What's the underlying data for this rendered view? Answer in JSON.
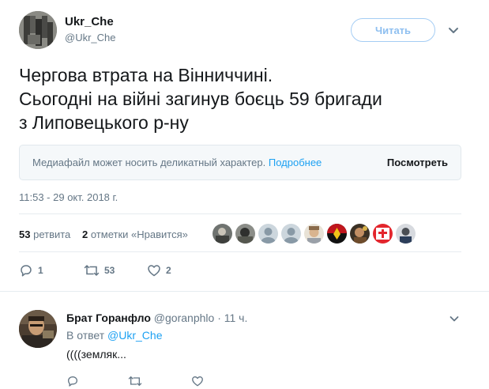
{
  "tweet": {
    "author_name": "Ukr_Che",
    "author_handle": "@Ukr_Che",
    "follow_label": "Читать",
    "text_lines": [
      "Чергова втрата на Вінниччині.",
      "Сьогодні на війні загинув боєць 59 бригади",
      "з Липовецького р-ну"
    ],
    "media_warning": {
      "message": "Медиафайл может носить деликатный характер.",
      "more_link": "Подробнее",
      "view_label": "Посмотреть"
    },
    "timestamp": "11:53 - 29 окт. 2018 г.",
    "stats": {
      "retweets_count": "53",
      "retweets_label": "ретвита",
      "likes_count": "2",
      "likes_label": "отметки «Нравится»"
    },
    "actions": {
      "reply_count": "1",
      "retweet_count": "53",
      "like_count": "2"
    }
  },
  "reply": {
    "author_name": "Брат Горанфло",
    "author_handle": "@goranphlo",
    "separator": "·",
    "time": "11 ч.",
    "reply_to_prefix": "В ответ",
    "reply_to_mention": "@Ukr_Che",
    "text": "((((земляк..."
  },
  "colors": {
    "accent": "#1da1f2",
    "secondary_text": "#657786",
    "primary_text": "#14171a",
    "border": "#e6ecf0"
  }
}
